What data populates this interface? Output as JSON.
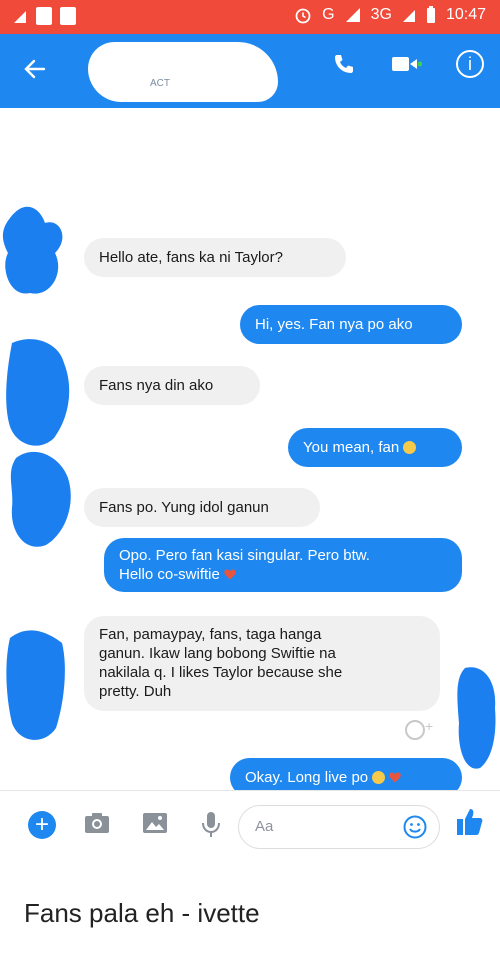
{
  "statusbar": {
    "network": "G",
    "network2": "3G",
    "network_sup": "3G",
    "time": "10:47"
  },
  "appbar": {
    "back_icon": "arrow-left-icon",
    "name_partial": "ACT",
    "icons": [
      "phone-icon",
      "video-camera-icon",
      "info-icon"
    ]
  },
  "messages": [
    {
      "side": "in",
      "text": "Hello ate, fans ka ni Taylor?"
    },
    {
      "side": "out",
      "text": "Hi, yes. Fan nya po ako"
    },
    {
      "side": "in",
      "text": "Fans nya din ako"
    },
    {
      "side": "out",
      "text": "You mean, fan"
    },
    {
      "side": "in",
      "text": "Fans po. Yung idol ganun"
    },
    {
      "side": "out",
      "line1": "Opo. Pero fan kasi singular. Pero btw.",
      "line2": "Hello co-swiftie"
    },
    {
      "side": "in",
      "line1": "Fan, pamaypay, fans, taga hanga",
      "line2": "ganun. Ikaw lang bobong Swiftie na",
      "line3": "nakilala q. I likes Taylor because she",
      "line4": "pretty. Duh"
    },
    {
      "side": "out",
      "text": "Okay. Long live po"
    }
  ],
  "composer": {
    "placeholder": "Aa"
  },
  "caption": "Fans pala eh - ivette",
  "colors": {
    "messenger_blue": "#1e88f0",
    "statusbar_red": "#ef4a3a",
    "incoming_bubble": "#f1f0f0",
    "heart": "#e8553e"
  }
}
